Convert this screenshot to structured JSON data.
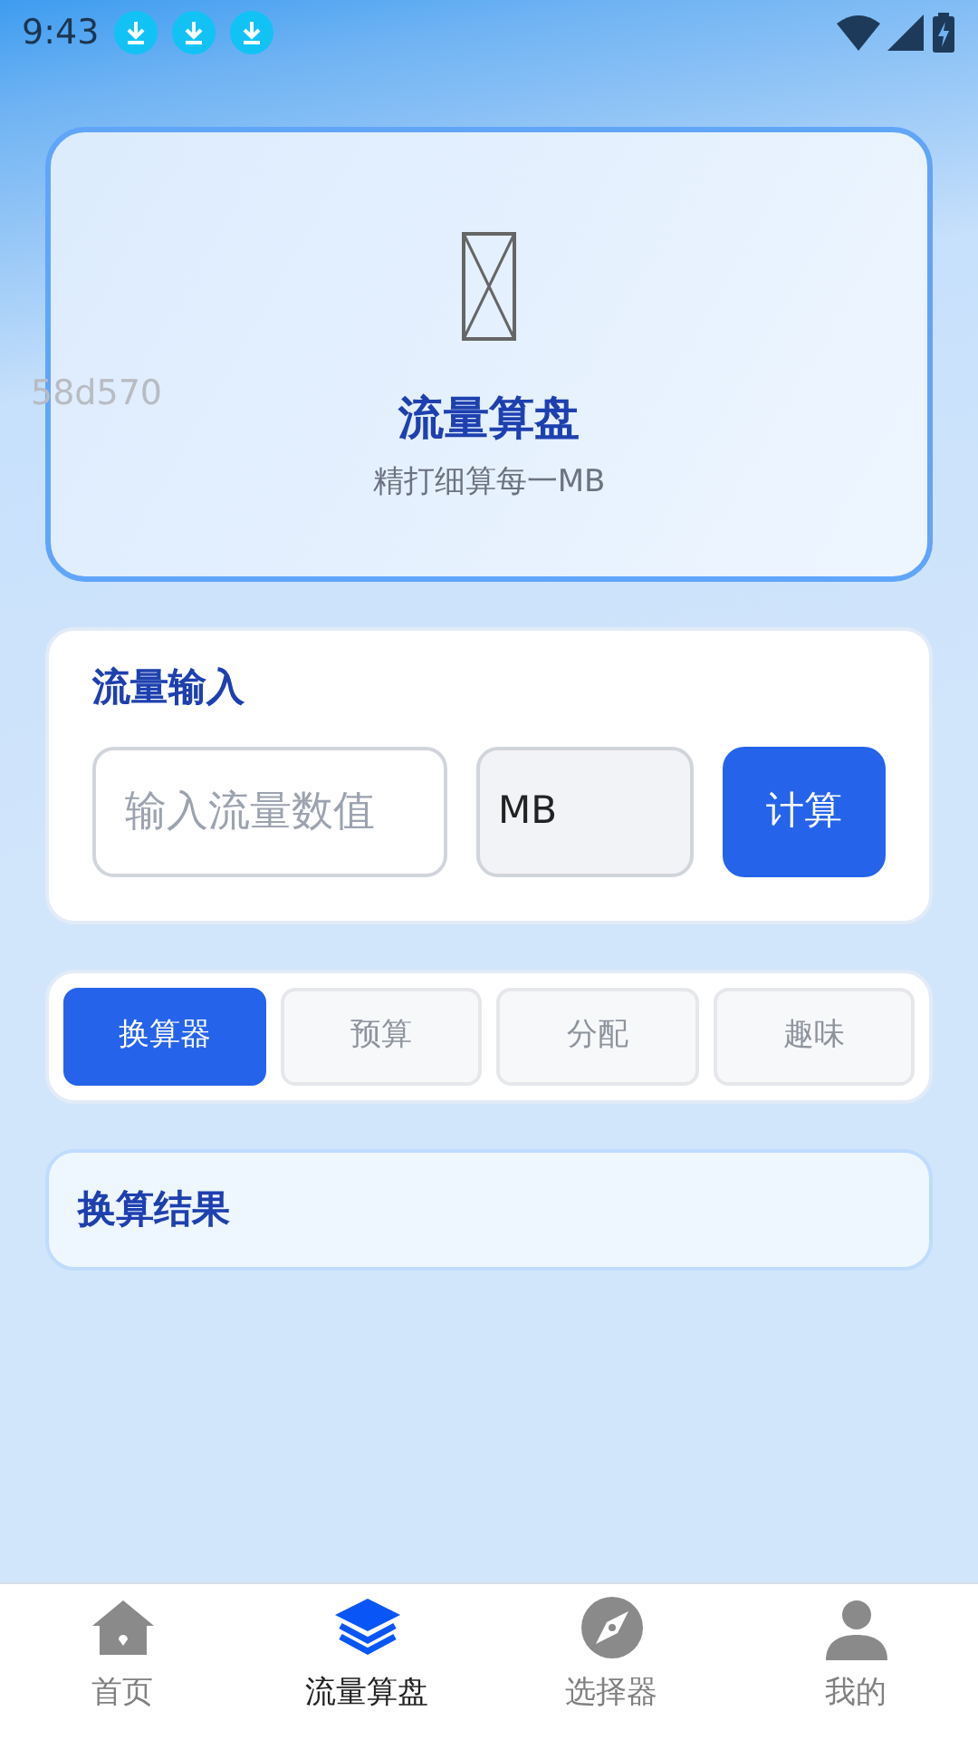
{
  "status_bar": {
    "time": "9:43"
  },
  "header": {
    "title": "流量算盘",
    "subtitle": "精打细算每一MB",
    "debug_text": "58d570"
  },
  "input_card": {
    "title": "流量输入",
    "placeholder": "输入流量数值",
    "unit": "MB",
    "button": "计算"
  },
  "tabs": [
    {
      "label": "换算器",
      "selected": true
    },
    {
      "label": "预算",
      "selected": false
    },
    {
      "label": "分配",
      "selected": false
    },
    {
      "label": "趣味",
      "selected": false
    }
  ],
  "result_card": {
    "title": "换算结果"
  },
  "bottom_nav": [
    {
      "label": "首页",
      "selected": false
    },
    {
      "label": "流量算盘",
      "selected": true
    },
    {
      "label": "选择器",
      "selected": false
    },
    {
      "label": "我的",
      "selected": false
    }
  ]
}
